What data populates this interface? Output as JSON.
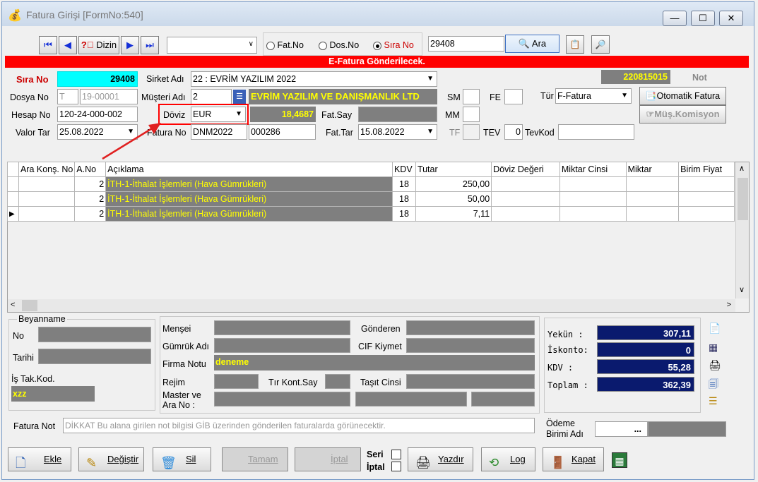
{
  "window": {
    "title": "Fatura Girişi [FormNo:540]"
  },
  "toolbar": {
    "dizin": "Dizin",
    "fatno": "Fat.No",
    "dosno": "Dos.No",
    "sirano": "Sıra No",
    "search_value": "29408",
    "ara": "Ara"
  },
  "banner": "E-Fatura Gönderilecek.",
  "header": {
    "sira_no_label": "Sıra No",
    "sira_no": "29408",
    "sirket_label": "Sirket Adı",
    "sirket": "22 : EVRİM YAZILIM  2022",
    "doc_no": "220815015",
    "not_label": "Not",
    "dosya_label": "Dosya No",
    "dosya_prefix": "T",
    "dosya_no": "19-00001",
    "musteri_label": "Müşteri Adı",
    "musteri_code": "2",
    "musteri_name": "EVRİM YAZILIM VE DANIŞMANLIK LTD",
    "sm_label": "SM",
    "fe_label": "FE",
    "tur_label": "Tür",
    "tur": "F-Fatura",
    "otomatik_btn": "Otomatik Fatura",
    "komisyon_btn": "Müş.Komisyon",
    "hesap_label": "Hesap No",
    "hesap": "120-24-000-002",
    "doviz_label": "Döviz",
    "doviz": "EUR",
    "kur": "18,4687",
    "fatsay_label": "Fat.Say",
    "mm_label": "MM",
    "valor_label": "Valor Tar",
    "valor": "25.08.2022",
    "faturano_label": "Fatura No",
    "faturano_prefix": "DNM2022",
    "faturano": "000286",
    "fattar_label": "Fat.Tar",
    "fattar": "15.08.2022",
    "tf_label": "TF",
    "tev_label": "TEV",
    "tev": "0",
    "tevkod_label": "TevKod"
  },
  "grid": {
    "columns": [
      "Ara Konş. No",
      "A.No",
      "Açıklama",
      "KDV",
      "Tutar",
      "Döviz Değeri",
      "Miktar Cinsi",
      "Miktar",
      "Birim Fiyat"
    ],
    "rows": [
      {
        "ano": "2",
        "aciklama": "İTH-1-İthalat İşlemleri  (Hava Gümrükleri)",
        "kdv": "18",
        "tutar": "250,00"
      },
      {
        "ano": "2",
        "aciklama": "İTH-1-İthalat İşlemleri  (Hava Gümrükleri)",
        "kdv": "18",
        "tutar": "50,00"
      },
      {
        "ano": "2",
        "aciklama": "İTH-1-İthalat İşlemleri  (Hava Gümrükleri)",
        "kdv": "18",
        "tutar": "7,11"
      }
    ]
  },
  "beyanname": {
    "title": "Beyanname",
    "no": "No",
    "tarihi": "Tarihi",
    "istak": "İş Tak.Kod.",
    "istak_val": "xzz"
  },
  "detail": {
    "mensei": "Menşei",
    "gonderen": "Gönderen",
    "gumruk": "Gümrük Adı",
    "cif": "CIF Kiymet",
    "firma": "Firma Notu",
    "firma_val": "deneme",
    "rejim": "Rejim",
    "tir": "Tır Kont.Say",
    "tasit": "Taşıt Cinsi",
    "master": "Master ve Ara No :"
  },
  "totals": {
    "yekun_label": "Yekün  :",
    "yekun": "307,11",
    "iskonto_label": "İskonto:",
    "iskonto": "0",
    "kdv_label": "KDV    :",
    "kdv": "55,28",
    "toplam_label": "Toplam :",
    "toplam": "362,39"
  },
  "footer": {
    "fatura_not_label": "Fatura Not",
    "fatura_not": "DİKKAT Bu alana girilen not bilgisi GİB üzerinden gönderilen faturalarda görünecektir.",
    "odeme_label": "Ödeme Birimi Adı",
    "odeme_btn": "..."
  },
  "buttons": {
    "ekle": "Ekle",
    "degistir": "Değiştir",
    "sil": "Sil",
    "tamam": "Tamam",
    "iptal": "İptal",
    "seri": "Seri",
    "iptal2": "İptal",
    "yazdir": "Yazdır",
    "log": "Log",
    "kapat": "Kapat"
  },
  "colors": {
    "accent_red": "#ff0000",
    "highlight_cyan": "#00ffff",
    "row_gray": "#7f7f7f",
    "yellow_text": "#ffff00",
    "navy": "#0a1a6e"
  }
}
